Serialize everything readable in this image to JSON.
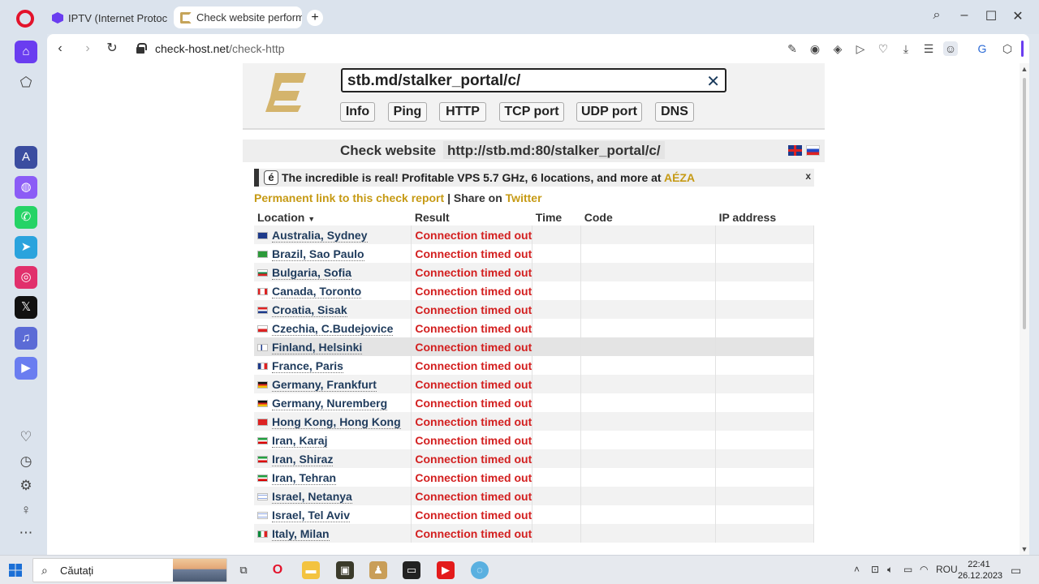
{
  "browser": {
    "tabs": [
      {
        "title": "IPTV (Internet Protocol"
      },
      {
        "title": "Check website performa"
      }
    ],
    "url_host": "check-host.net",
    "url_path": "/check-http"
  },
  "search": {
    "value": "stb.md/stalker_portal/c/",
    "clear": "✕"
  },
  "nav": [
    "Info",
    "Ping",
    "HTTP",
    "TCP port",
    "UDP port",
    "DNS"
  ],
  "check": {
    "title": "Check website",
    "url": "http://stb.md:80/stalker_portal/c/"
  },
  "ad": {
    "icon": "é",
    "text": "The incredible is real! Profitable VPS 5.7 GHz, 6 locations, and more at ",
    "brand": "AÉZA",
    "close": "x"
  },
  "links": {
    "permanent": "Permanent link to this check report",
    "separator": "|",
    "share_prefix": "Share on",
    "twitter": "Twitter"
  },
  "table": {
    "headers": {
      "location": "Location",
      "location_caret": "▼",
      "result": "Result",
      "time": "Time",
      "code": "Code",
      "ip": "IP address"
    },
    "rows": [
      {
        "location": "Australia, Sydney",
        "result": "Connection timed out"
      },
      {
        "location": "Brazil, Sao Paulo",
        "result": "Connection timed out"
      },
      {
        "location": "Bulgaria, Sofia",
        "result": "Connection timed out"
      },
      {
        "location": "Canada, Toronto",
        "result": "Connection timed out"
      },
      {
        "location": "Croatia, Sisak",
        "result": "Connection timed out"
      },
      {
        "location": "Czechia, C.Budejovice",
        "result": "Connection timed out"
      },
      {
        "location": "Finland, Helsinki",
        "result": "Connection timed out"
      },
      {
        "location": "France, Paris",
        "result": "Connection timed out"
      },
      {
        "location": "Germany, Frankfurt",
        "result": "Connection timed out"
      },
      {
        "location": "Germany, Nuremberg",
        "result": "Connection timed out"
      },
      {
        "location": "Hong Kong, Hong Kong",
        "result": "Connection timed out"
      },
      {
        "location": "Iran, Karaj",
        "result": "Connection timed out"
      },
      {
        "location": "Iran, Shiraz",
        "result": "Connection timed out"
      },
      {
        "location": "Iran, Tehran",
        "result": "Connection timed out"
      },
      {
        "location": "Israel, Netanya",
        "result": "Connection timed out"
      },
      {
        "location": "Israel, Tel Aviv",
        "result": "Connection timed out"
      },
      {
        "location": "Italy, Milan",
        "result": "Connection timed out"
      }
    ]
  },
  "taskbar": {
    "search_label": "Căutați",
    "language": "ROU",
    "time": "22:41",
    "date": "26.12.2023"
  },
  "colors": {
    "accent_gold": "#c69a14",
    "error_red": "#d31f1f",
    "link_navy": "#1f3b5c"
  }
}
